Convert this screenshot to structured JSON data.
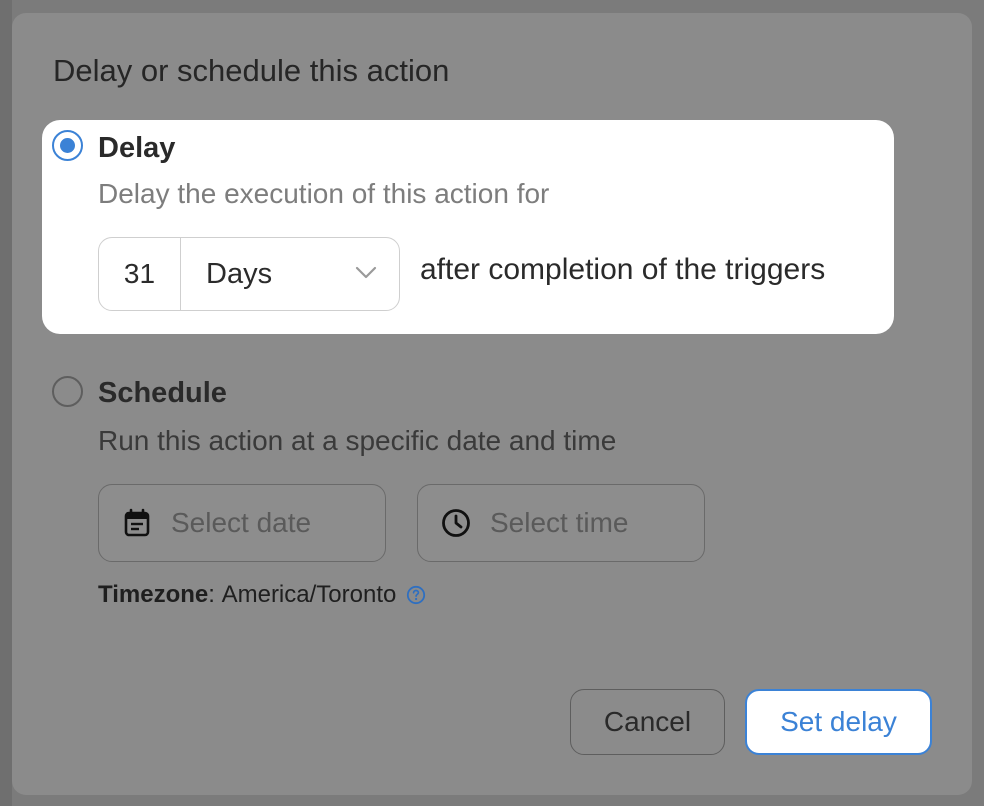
{
  "dialog": {
    "title": "Delay or schedule this action"
  },
  "delay_option": {
    "label": "Delay",
    "description": "Delay the execution of this action for",
    "selected": true,
    "amount": "31",
    "unit": "Days",
    "suffix": "after completion of the triggers"
  },
  "schedule_option": {
    "label": "Schedule",
    "description": "Run this action at a specific date and time",
    "selected": false,
    "date_placeholder": "Select date",
    "time_placeholder": "Select time"
  },
  "timezone": {
    "label": "Timezone",
    "separator": ":",
    "value": "America/Toronto"
  },
  "buttons": {
    "cancel": "Cancel",
    "confirm": "Set delay"
  },
  "icons": {
    "date": "calendar-icon",
    "time": "clock-icon",
    "help": "help-circle-icon",
    "dropdown": "chevron-down-icon"
  },
  "colors": {
    "accent": "#3b82d6",
    "overlay": "#8b8b8b",
    "card": "#ffffff"
  }
}
